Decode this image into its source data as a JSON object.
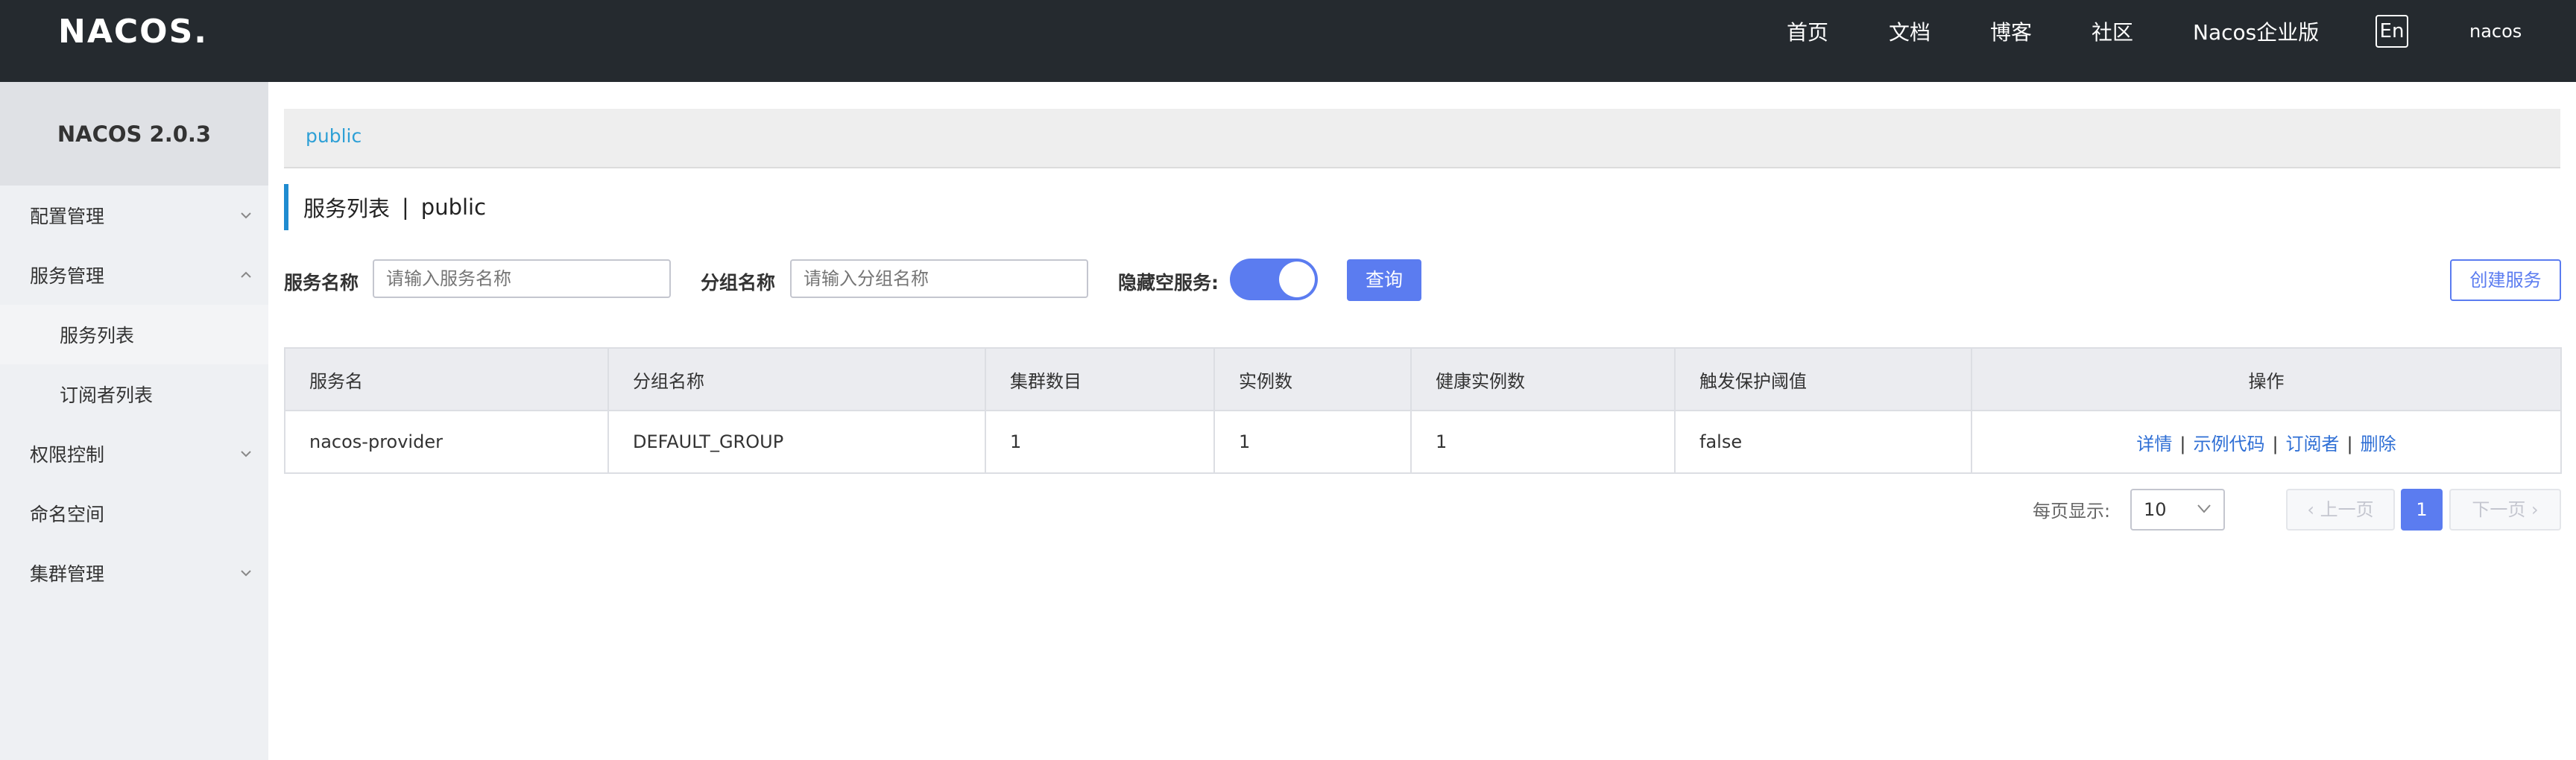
{
  "header": {
    "logo_text": "NACOS.",
    "nav": [
      "首页",
      "文档",
      "博客",
      "社区",
      "Nacos企业版"
    ],
    "lang": "En",
    "user": "nacos"
  },
  "sidebar": {
    "version": "NACOS 2.0.3",
    "items": [
      {
        "label": "配置管理",
        "expanded": false
      },
      {
        "label": "服务管理",
        "expanded": true
      },
      {
        "label": "服务列表",
        "sub": true,
        "active": true
      },
      {
        "label": "订阅者列表",
        "sub": true
      },
      {
        "label": "权限控制",
        "expanded": false
      },
      {
        "label": "命名空间"
      },
      {
        "label": "集群管理",
        "expanded": false
      }
    ]
  },
  "breadcrumb": "public",
  "page_title": {
    "main": "服务列表",
    "sep": "|",
    "ns": "public"
  },
  "filters": {
    "service_name_label": "服务名称",
    "service_name_placeholder": "请输入服务名称",
    "group_name_label": "分组名称",
    "group_name_placeholder": "请输入分组名称",
    "hide_empty_label": "隐藏空服务:",
    "hide_empty_on": true,
    "query_button": "查询",
    "create_button": "创建服务"
  },
  "table": {
    "columns": [
      "服务名",
      "分组名称",
      "集群数目",
      "实例数",
      "健康实例数",
      "触发保护阈值",
      "操作"
    ],
    "rows": [
      {
        "service": "nacos-provider",
        "group": "DEFAULT_GROUP",
        "clusters": "1",
        "instances": "1",
        "healthy": "1",
        "protect": "false"
      }
    ],
    "actions": [
      "详情",
      "示例代码",
      "订阅者",
      "删除"
    ],
    "action_sep": "|"
  },
  "pagination": {
    "page_size_label": "每页显示:",
    "page_size": "10",
    "prev": "上一页",
    "current": "1",
    "next": "下一页"
  },
  "colors": {
    "topbar": "#252a2f",
    "primary": "#5b7cf0",
    "link": "#2f6fd5",
    "breadcrumb": "#2ea0d6"
  }
}
